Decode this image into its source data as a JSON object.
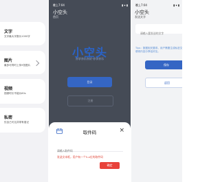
{
  "colors": {
    "accent": "#3566c4",
    "danger": "#e8423a",
    "overlay": "#454b56"
  },
  "left": {
    "items": [
      {
        "title": "文字",
        "desc": "文字最大字数为1000字"
      },
      {
        "title": "图片",
        "desc": "最多可同时上传9张图片"
      },
      {
        "title": "视频",
        "desc": "视频时长不能为60s"
      },
      {
        "title": "私密",
        "desc": "仅自己可见并带有邀记"
      }
    ]
  },
  "mid": {
    "status_time": "晚上7:04",
    "status_icons": "▮ ▾ ▮",
    "title": "小空头",
    "subtitle": "首页",
    "hero": "小空头",
    "slogan": "亦学亦乐亦好·亦学亦乐",
    "btn_primary": "登录",
    "btn_secondary": "注册"
  },
  "sheet": {
    "title": "取件码",
    "close": "×",
    "input_placeholder": "请输入取件码",
    "warning": "发送文本框，用户有一个5-a位的取件码",
    "button": "确定"
  },
  "right": {
    "status_time": "晚上7:04",
    "status_icons": "▮ ▾ ▮",
    "title": "小空头",
    "subtitle": "发送文字",
    "input_placeholder": "请输入要发送的文字",
    "tips": "Tips：数据相关要求。用户需要生成私密文字，以便将内容分享给好友。",
    "save": "保存",
    "back": "返回"
  }
}
